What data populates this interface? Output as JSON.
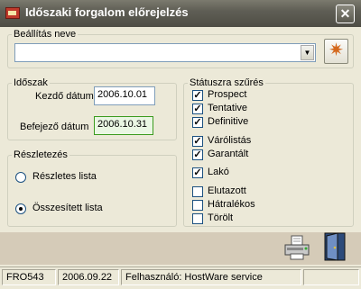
{
  "window": {
    "title": "Időszaki forgalom előrejelzés",
    "close_label": "✕"
  },
  "settings": {
    "legend": "Beállítás neve",
    "value": "",
    "dropdown_arrow": "▼"
  },
  "period": {
    "legend": "Időszak",
    "start_label": "Kezdő dátum",
    "start_value": "2006.10.01",
    "end_label": "Befejező dátum",
    "end_value": "2006.10.31"
  },
  "detail": {
    "legend": "Részletezés",
    "options": [
      {
        "label": "Részletes lista",
        "selected": false
      },
      {
        "label": "Összesített lista",
        "selected": true
      }
    ]
  },
  "status_filter": {
    "legend": "Státuszra szűrés",
    "items": [
      {
        "label": "Prospect",
        "checked": true
      },
      {
        "label": "Tentative",
        "checked": true
      },
      {
        "label": "Definitive",
        "checked": true
      },
      {
        "label": "Várólistás",
        "checked": true
      },
      {
        "label": "Garantált",
        "checked": true
      },
      {
        "label": "Lakó",
        "checked": true
      },
      {
        "label": "Elutazott",
        "checked": false
      },
      {
        "label": "Hátralékos",
        "checked": false
      },
      {
        "label": "Törölt",
        "checked": false
      }
    ]
  },
  "statusbar": {
    "code": "FRO543",
    "date": "2006.09.22",
    "user": "Felhasználó: HostWare service"
  },
  "icons": {
    "star": "star-icon",
    "printer": "printer-icon",
    "exit": "exit-door-icon"
  },
  "colors": {
    "titlebar": "#5f5e55",
    "bottom_area": "#d5cbb8",
    "active_input": "#eaf6e3"
  }
}
